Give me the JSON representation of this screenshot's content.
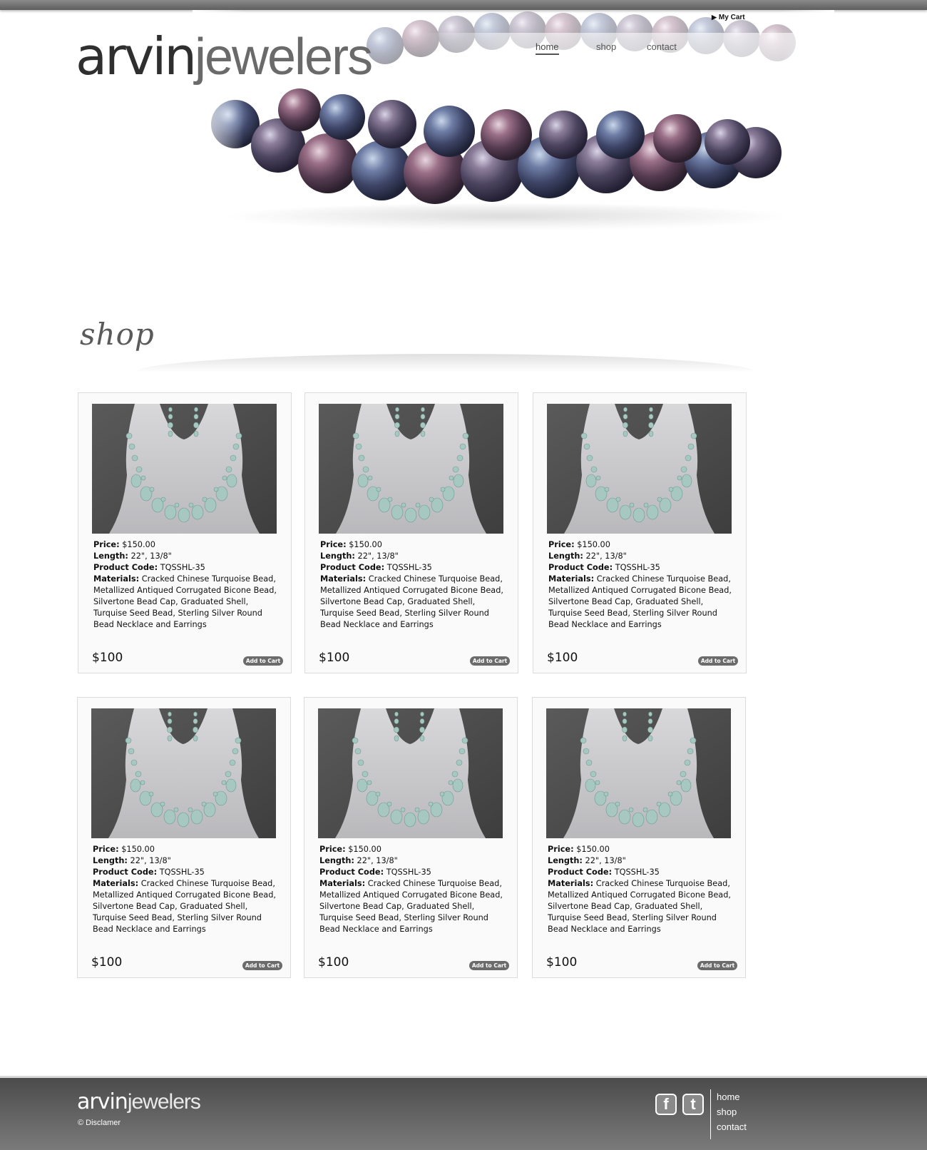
{
  "header": {
    "brand_part1": "arvin",
    "brand_part2": "jewelers",
    "cart_label": "My Cart",
    "nav": {
      "home": "home",
      "shop": "shop",
      "contact": "contact"
    }
  },
  "section": {
    "title": "shop"
  },
  "products": [
    {
      "price_label": "Price:",
      "price": "$150.00",
      "length_label": "Length:",
      "length": "22\", 13/8\"",
      "code_label": "Product Code:",
      "code": "TQSSHL-35",
      "materials_label": "Materials:",
      "materials": "Cracked Chinese Turquoise Bead, Metallized Antiqued Corrugated Bicone Bead, Silvertone Bead Cap, Graduated Shell, Turquise Seed Bead, Sterling Silver Round Bead Necklace and Earrings",
      "sale_price": "$100",
      "add_label": "Add to Cart"
    },
    {
      "price_label": "Price:",
      "price": "$150.00",
      "length_label": "Length:",
      "length": "22\", 13/8\"",
      "code_label": "Product Code:",
      "code": "TQSSHL-35",
      "materials_label": "Materials:",
      "materials": "Cracked Chinese Turquoise Bead, Metallized Antiqued Corrugated Bicone Bead, Silvertone Bead Cap, Graduated Shell, Turquise Seed Bead, Sterling Silver Round Bead Necklace and Earrings",
      "sale_price": "$100",
      "add_label": "Add to Cart"
    },
    {
      "price_label": "Price:",
      "price": "$150.00",
      "length_label": "Length:",
      "length": "22\", 13/8\"",
      "code_label": "Product Code:",
      "code": "TQSSHL-35",
      "materials_label": "Materials:",
      "materials": "Cracked Chinese Turquoise Bead, Metallized Antiqued Corrugated Bicone Bead, Silvertone Bead Cap, Graduated Shell, Turquise Seed Bead, Sterling Silver Round Bead Necklace and Earrings",
      "sale_price": "$100",
      "add_label": "Add to Cart"
    },
    {
      "price_label": "Price:",
      "price": "$150.00",
      "length_label": "Length:",
      "length": "22\", 13/8\"",
      "code_label": "Product Code:",
      "code": "TQSSHL-35",
      "materials_label": "Materials:",
      "materials": "Cracked Chinese Turquoise Bead, Metallized Antiqued Corrugated Bicone Bead, Silvertone Bead Cap, Graduated Shell, Turquise Seed Bead, Sterling Silver Round Bead Necklace and Earrings",
      "sale_price": "$100",
      "add_label": "Add to Cart"
    },
    {
      "price_label": "Price:",
      "price": "$150.00",
      "length_label": "Length:",
      "length": "22\", 13/8\"",
      "code_label": "Product Code:",
      "code": "TQSSHL-35",
      "materials_label": "Materials:",
      "materials": "Cracked Chinese Turquoise Bead, Metallized Antiqued Corrugated Bicone Bead, Silvertone Bead Cap, Graduated Shell, Turquise Seed Bead, Sterling Silver Round Bead Necklace and Earrings",
      "sale_price": "$100",
      "add_label": "Add to Cart"
    },
    {
      "price_label": "Price:",
      "price": "$150.00",
      "length_label": "Length:",
      "length": "22\", 13/8\"",
      "code_label": "Product Code:",
      "code": "TQSSHL-35",
      "materials_label": "Materials:",
      "materials": "Cracked Chinese Turquoise Bead, Metallized Antiqued Corrugated Bicone Bead, Silvertone Bead Cap, Graduated Shell, Turquise Seed Bead, Sterling Silver Round Bead Necklace and Earrings",
      "sale_price": "$100",
      "add_label": "Add to Cart"
    }
  ],
  "footer": {
    "brand_part1": "arvin",
    "brand_part2": "jewelers",
    "disclaimer": "© Disclamer",
    "facebook_glyph": "f",
    "twitter_glyph": "t",
    "links": {
      "home": "home",
      "shop": "shop",
      "contact": "contact"
    }
  },
  "icons": [
    "facebook-icon",
    "twitter-icon",
    "cart-arrow-icon"
  ],
  "colors": {
    "accent": "#6b6b6b",
    "footer": "#5e5e5e"
  }
}
